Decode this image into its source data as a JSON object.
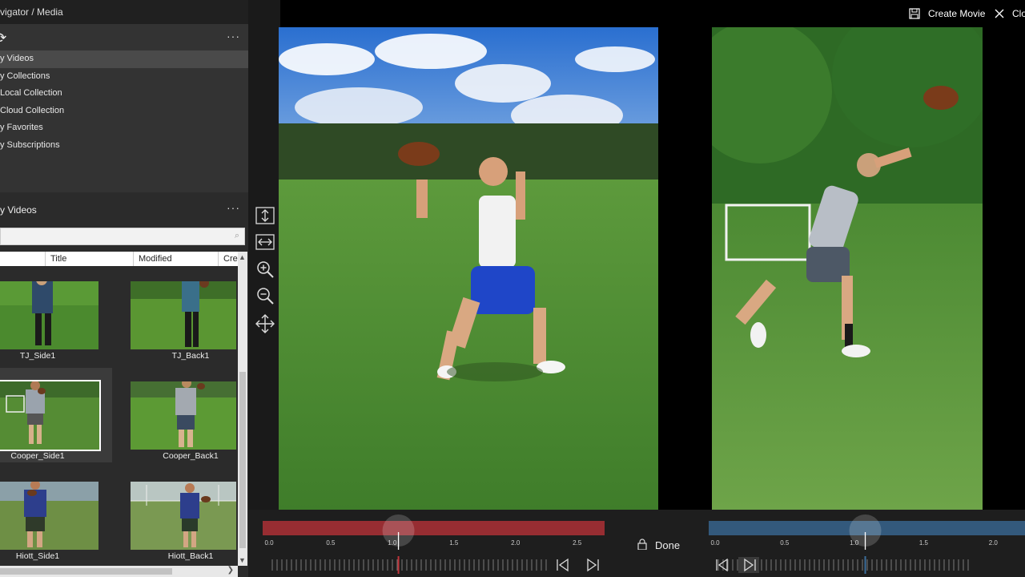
{
  "window": {
    "title": "vigator / Media"
  },
  "navigator": {
    "items": [
      {
        "label": "y Videos",
        "active": true
      },
      {
        "label": "y Collections",
        "active": false
      },
      {
        "label": "Local Collection",
        "active": false
      },
      {
        "label": "Cloud Collection",
        "active": false
      },
      {
        "label": "y Favorites",
        "active": false
      },
      {
        "label": "y Subscriptions",
        "active": false
      }
    ]
  },
  "library": {
    "title": "y Videos",
    "search_placeholder": "",
    "columns": [
      "Title",
      "Modified",
      "Cre"
    ],
    "tiles": [
      {
        "caption": "TJ_Side1",
        "selected": false
      },
      {
        "caption": "TJ_Back1",
        "selected": false
      },
      {
        "caption": "Cooper_Side1",
        "selected": true
      },
      {
        "caption": "Cooper_Back1",
        "selected": false
      },
      {
        "caption": "Hiott_Side1",
        "selected": false
      },
      {
        "caption": "Hiott_Back1",
        "selected": false
      }
    ]
  },
  "toolbar": {
    "create_movie_label": "Create Movie",
    "close_label": "Clo"
  },
  "timeline": {
    "done_label": "Done",
    "left_ticks": [
      "0.0",
      "0.5",
      "1.0",
      "1.5",
      "2.0",
      "2.5"
    ],
    "right_ticks": [
      "0.0",
      "0.5",
      "1.0",
      "1.5",
      "2.0"
    ],
    "left_playhead": 1.05,
    "right_playhead": 1.08,
    "left_color": "#c0333a",
    "right_color": "#3b6e9c"
  },
  "icons": {
    "fit_vertical": "fit-vertical-icon",
    "fit_horizontal": "fit-horizontal-icon",
    "zoom_in": "zoom-in-icon",
    "zoom_out": "zoom-out-icon",
    "move": "move-icon",
    "lock": "lock-icon"
  }
}
